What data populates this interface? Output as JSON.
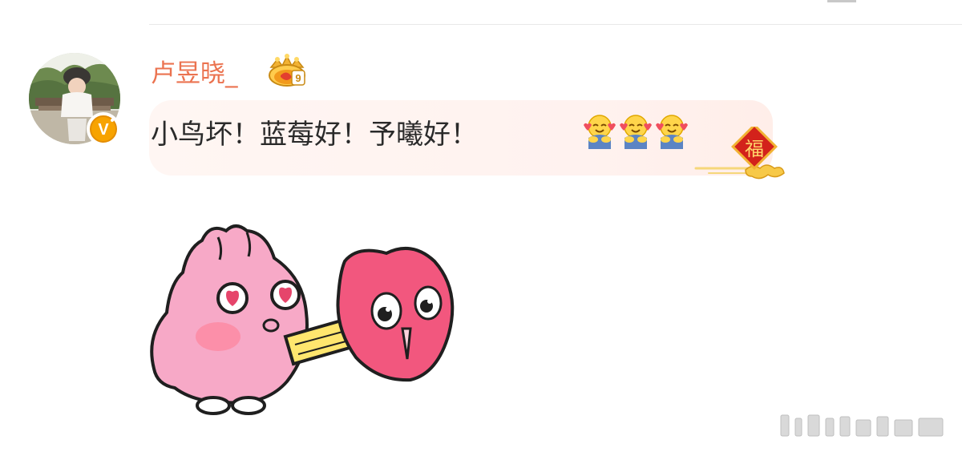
{
  "comment": {
    "username": "卢昱晓_",
    "text": "小鸟坏！蓝莓好！予曦好！",
    "emojis": [
      "hug-emoji",
      "hug-emoji",
      "hug-emoji"
    ],
    "badge": {
      "icon": "fu-lucky-badge-icon",
      "character": "福"
    },
    "level_badge": {
      "icon": "crown-level-badge-icon",
      "level": "9"
    },
    "verified_badge": {
      "icon": "verified-v-icon",
      "letter": "V"
    },
    "sticker": {
      "icon": "pink-rabbit-kissing-heart-sticker"
    }
  },
  "watermark": {
    "icon": "watermark-icon"
  },
  "colors": {
    "username": "#eb7350",
    "text": "#2a2a2a",
    "bubble": "#fff4f1",
    "verified": "#f7a300",
    "badge_red": "#d3221b",
    "badge_gold": "#f2b233"
  }
}
